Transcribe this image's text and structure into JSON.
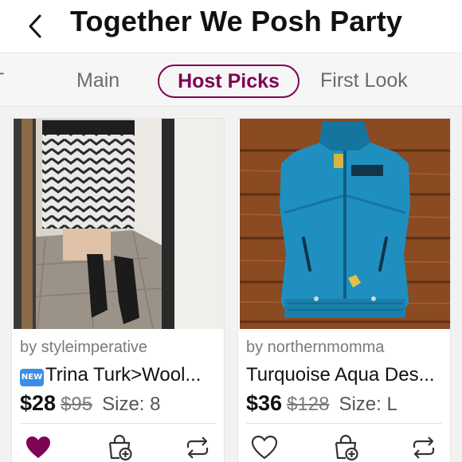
{
  "header": {
    "title": "Together We Posh Party",
    "back_icon": "chevron-left-icon"
  },
  "tabs": [
    {
      "label": "T",
      "active": false
    },
    {
      "label": "Main",
      "active": false
    },
    {
      "label": "Host Picks",
      "active": true
    },
    {
      "label": "First Look",
      "active": false
    }
  ],
  "colors": {
    "accent": "#7f0353",
    "like_filled": "#7f0353",
    "muted_text": "#7a7a7a"
  },
  "listings": [
    {
      "seller": "by styleimperative",
      "badge": "NEW",
      "title": "Trina Turk>Wool...",
      "price": "$28",
      "original_price": "$95",
      "size": "Size: 8",
      "liked": true,
      "icons": [
        "heart-filled-icon",
        "bundle-add-icon",
        "share-icon"
      ]
    },
    {
      "seller": "by northernmomma",
      "title": "Turquoise Aqua Des...",
      "price": "$36",
      "original_price": "$128",
      "size": "Size: L",
      "liked": false,
      "icons": [
        "heart-outline-icon",
        "bundle-add-icon",
        "share-icon"
      ]
    }
  ]
}
